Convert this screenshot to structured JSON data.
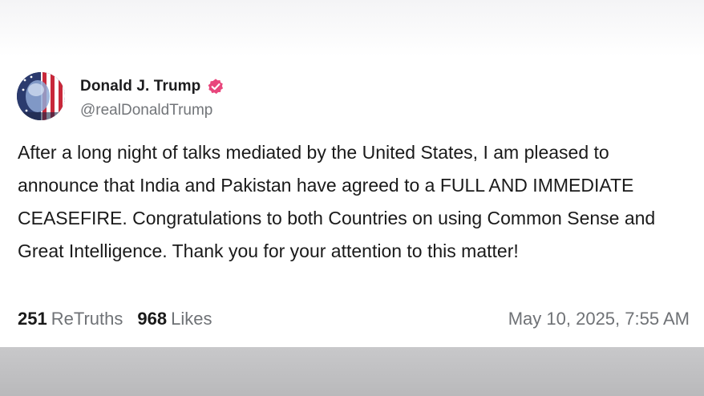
{
  "post": {
    "author": {
      "display_name": "Donald J. Trump",
      "handle": "@realDonaldTrump",
      "verified_icon": "verified-badge-icon",
      "verified_color": "#e8467c"
    },
    "body": "After a long night of talks mediated by the United States, I am pleased to announce that India and Pakistan have agreed to a FULL AND IMMEDIATE CEASEFIRE. Congratulations to both Countries on using Common Sense and Great Intelligence. Thank you for your attention to this matter!",
    "stats": {
      "retruths_count": "251",
      "retruths_label": "ReTruths",
      "likes_count": "968",
      "likes_label": "Likes"
    },
    "timestamp": "May 10, 2025, 7:55 AM"
  },
  "colors": {
    "text_primary": "#1a1a1a",
    "text_secondary": "#6f7276",
    "accent": "#e8467c",
    "bottom_band": "#c0c0c2"
  }
}
